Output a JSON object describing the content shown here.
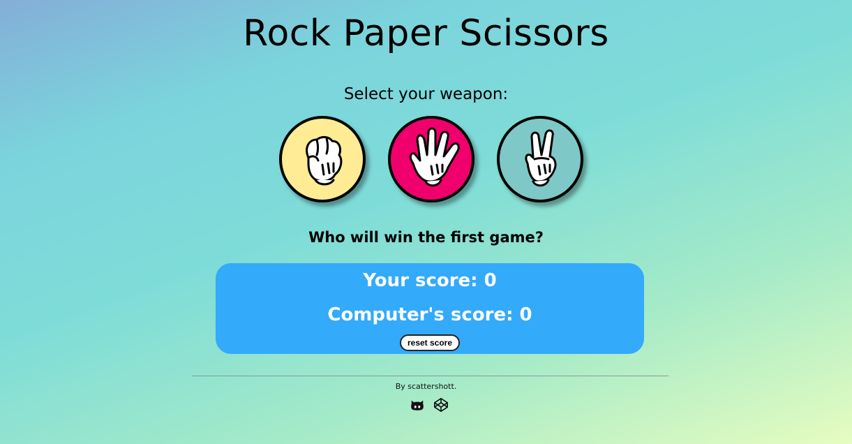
{
  "game": {
    "title": "Rock Paper Scissors",
    "select_prompt": "Select your weapon:",
    "weapons": [
      {
        "name": "rock",
        "icon": "fist-hand-icon",
        "color": "#ffec94"
      },
      {
        "name": "paper",
        "icon": "open-hand-icon",
        "color": "#f0006c"
      },
      {
        "name": "scissors",
        "icon": "peace-hand-icon",
        "color": "#7ec8c8"
      }
    ],
    "status_message": "Who will win the first game?",
    "score": {
      "player_label": "Your score: 0",
      "computer_label": "Computer's score: 0",
      "player": 0,
      "computer": 0,
      "panel_color": "#33aafa"
    },
    "reset_label": "reset score"
  },
  "footer": {
    "credit": "By scattershott.",
    "links": [
      {
        "icon": "github-icon"
      },
      {
        "icon": "codepen-icon"
      }
    ]
  }
}
